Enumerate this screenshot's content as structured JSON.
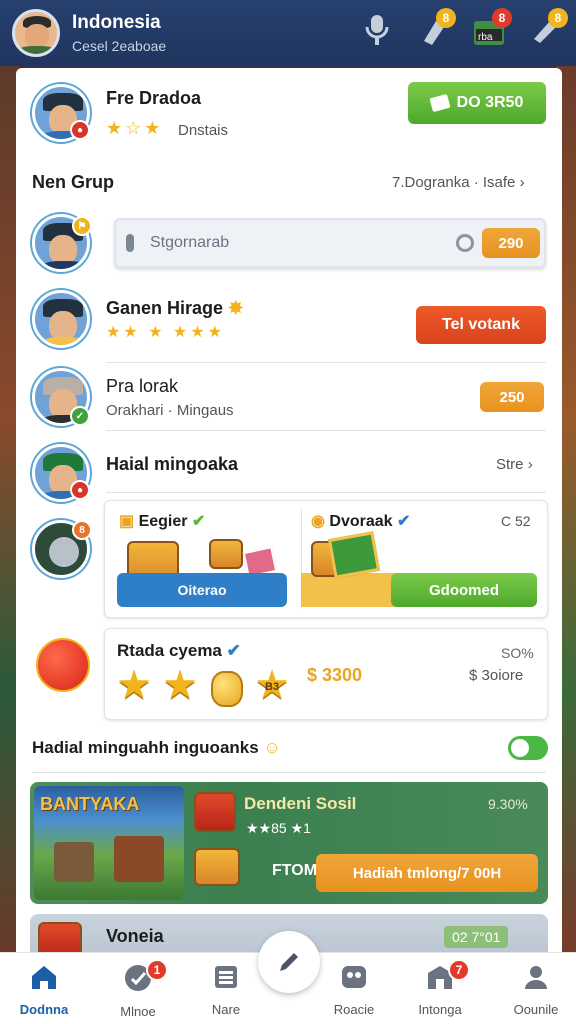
{
  "header": {
    "title": "Indonesia",
    "subtitle": "Cesel 2eaboae",
    "icons": [
      {
        "name": "microphone-icon"
      },
      {
        "name": "hand-icon",
        "badge": "8"
      },
      {
        "name": "gift-icon",
        "badge": "8",
        "label": "rba"
      },
      {
        "name": "megaphone-icon",
        "badge": "8"
      }
    ]
  },
  "profile": {
    "name": "Fre Dradoa",
    "rank": "Dnstais",
    "action_button": "DO 3R50"
  },
  "group_section": {
    "title": "Nen Grup",
    "link": "7.Dogranka · Isafe"
  },
  "search": {
    "placeholder": "Stgornarab",
    "value_badge": "290"
  },
  "rows": [
    {
      "name": "Ganen Hirage",
      "button": "Tel votank"
    },
    {
      "name": "Pra lorak",
      "sub": "Orakhari · Mingaus",
      "value": "250"
    },
    {
      "name": "Haial mingoaka",
      "link": "Stre"
    }
  ],
  "reward_cards": {
    "left": {
      "title": "Eegier",
      "button": "Oiterao"
    },
    "right": {
      "title": "Dvoraak",
      "meta": "C 52",
      "button": "Gdoomed"
    }
  },
  "daily_card": {
    "title": "Rtada cyema",
    "amount": "$ 3300",
    "percent": "SO%",
    "sub_amount": "$ 3oiore",
    "coin_label": "B3"
  },
  "hadial": {
    "title": "Hadial minguahh inguoanks"
  },
  "promo": {
    "art_label": "BANTYAKA",
    "title": "Dendeni Sosil",
    "stars": "★★85 ★1",
    "percent": "9.30%",
    "small_label": "FTOM",
    "button": "Hadiah tmlong/7 00H"
  },
  "promo2": {
    "title": "Voneia",
    "value": "02 7°01"
  },
  "nav": [
    {
      "label": "Dodnna",
      "icon": "home-icon",
      "active": true
    },
    {
      "label": "Mlnoe",
      "icon": "compass-icon",
      "badge": "1"
    },
    {
      "label": "Nare",
      "icon": "list-icon"
    },
    {
      "label": "Roacie",
      "icon": "mask-icon"
    },
    {
      "label": "Intonga",
      "icon": "shop-icon",
      "badge": "7"
    },
    {
      "label": "Oounile",
      "icon": "profile-icon"
    }
  ],
  "colors": {
    "header_bg": "#27406e",
    "accent_green": "#4ea82c",
    "accent_orange": "#e8921f",
    "accent_red": "#d8431c",
    "nav_active": "#1c5fa8"
  }
}
